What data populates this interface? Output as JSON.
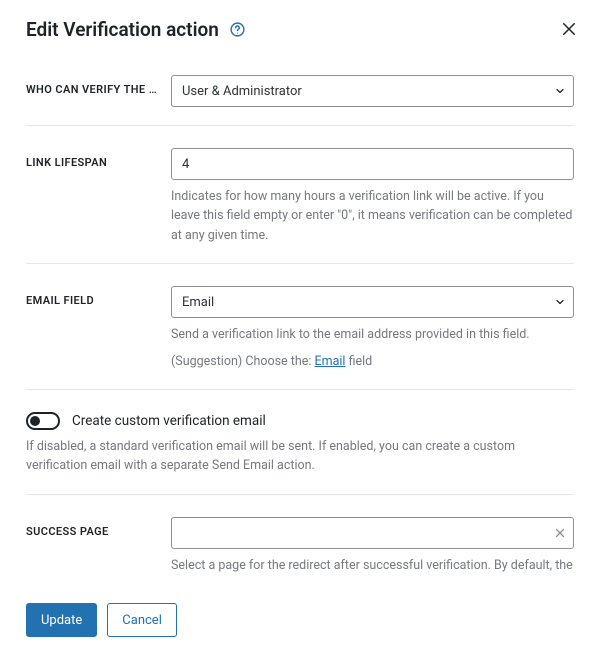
{
  "header": {
    "title": "Edit Verification action"
  },
  "fields": {
    "who_can_verify": {
      "label": "WHO CAN VERIFY THE S…",
      "value": "User & Administrator"
    },
    "link_lifespan": {
      "label": "LINK LIFESPAN",
      "value": "4",
      "hint": "Indicates for how many hours a verification link will be active. If you leave this field empty or enter \"0\", it means verification can be completed at any given time."
    },
    "email_field": {
      "label": "EMAIL FIELD",
      "value": "Email",
      "hint1": "Send a verification link to the email address provided in this field.",
      "hint2_prefix": "(Suggestion) Choose the: ",
      "hint2_link": "Email",
      "hint2_suffix": " field"
    },
    "custom_email": {
      "toggle_label": "Create custom verification email",
      "enabled": false,
      "hint": "If disabled, a standard verification email will be sent. If enabled, you can create a custom verification email with a separate Send Email action."
    },
    "success_page": {
      "label": "SUCCESS PAGE",
      "value": "",
      "hint": "Select a page for the redirect after successful verification. By default, the"
    }
  },
  "footer": {
    "update": "Update",
    "cancel": "Cancel"
  }
}
